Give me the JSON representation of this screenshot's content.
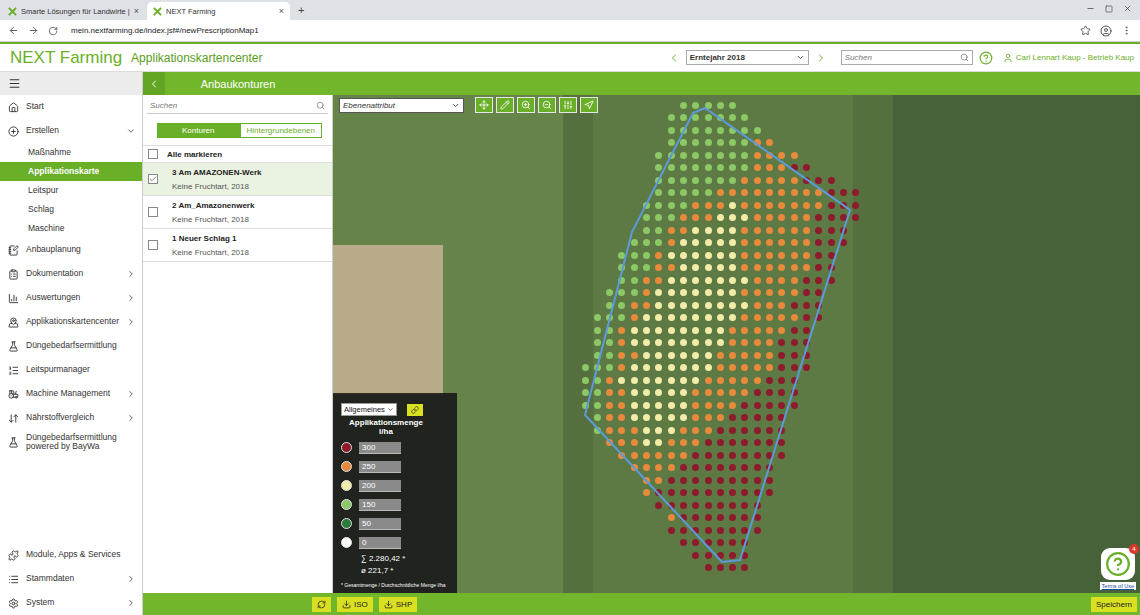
{
  "browser": {
    "tabs": [
      {
        "label": "Smarte Lösungen für Landwirte |",
        "close": "×",
        "selected": false
      },
      {
        "label": "NEXT Farming",
        "close": "×",
        "selected": true
      }
    ],
    "new_tab": "+",
    "url": "mein.nextfarming.de/index.jsf#/newPrescriptionMap1"
  },
  "app_header": {
    "logo": "NEXT Farming",
    "title": "Applikationskartencenter",
    "year": "Erntejahr 2018",
    "search_placeholder": "Suchen",
    "user": "Carl Lennart Kaup - Betrieb Kaup"
  },
  "sidebar": {
    "items": [
      {
        "label": "Start",
        "kind": "top",
        "expandable": false,
        "expanded": false,
        "selected": false
      },
      {
        "label": "Erstellen",
        "kind": "top",
        "expandable": true,
        "expanded": true,
        "selected": false
      },
      {
        "label": "Maßnahme",
        "kind": "sub",
        "expandable": false,
        "expanded": false,
        "selected": false
      },
      {
        "label": "Applikationskarte",
        "kind": "sub",
        "expandable": false,
        "expanded": false,
        "selected": true
      },
      {
        "label": "Leitspur",
        "kind": "sub",
        "expandable": false,
        "expanded": false,
        "selected": false
      },
      {
        "label": "Schlag",
        "kind": "sub",
        "expandable": false,
        "expanded": false,
        "selected": false
      },
      {
        "label": "Maschine",
        "kind": "sub",
        "expandable": false,
        "expanded": false,
        "selected": false
      },
      {
        "label": "Anbauplanung",
        "kind": "top",
        "expandable": false,
        "expanded": false,
        "selected": false
      },
      {
        "label": "Dokumentation",
        "kind": "top",
        "expandable": true,
        "expanded": false,
        "selected": false
      },
      {
        "label": "Auswertungen",
        "kind": "top",
        "expandable": true,
        "expanded": false,
        "selected": false
      },
      {
        "label": "Applikationskartencenter",
        "kind": "top",
        "expandable": true,
        "expanded": false,
        "selected": false
      },
      {
        "label": "Düngebedarfsermittlung",
        "kind": "top",
        "expandable": false,
        "expanded": false,
        "selected": false
      },
      {
        "label": "Leitspurmanager",
        "kind": "top",
        "expandable": false,
        "expanded": false,
        "selected": false
      },
      {
        "label": "Machine Management",
        "kind": "top",
        "expandable": true,
        "expanded": false,
        "selected": false
      },
      {
        "label": "Nährstoffvergleich",
        "kind": "top",
        "expandable": true,
        "expanded": false,
        "selected": false
      },
      {
        "label": "Düngebedarfsermittlung powered by BayWa",
        "kind": "top",
        "expandable": false,
        "expanded": false,
        "selected": false
      }
    ],
    "footer_items": [
      {
        "label": "Module, Apps & Services",
        "kind": "top",
        "expandable": false,
        "expanded": false,
        "selected": false
      },
      {
        "label": "Stammdaten",
        "kind": "top",
        "expandable": true,
        "expanded": false,
        "selected": false
      },
      {
        "label": "System",
        "kind": "top",
        "expandable": true,
        "expanded": false,
        "selected": false
      }
    ]
  },
  "panel": {
    "title": "Anbaukonturen",
    "search_placeholder": "Suchen",
    "toggle": [
      {
        "label": "Konturen",
        "selected": true
      },
      {
        "label": "Hintergrundebenen",
        "selected": false
      }
    ],
    "select_all": {
      "label": "Alle markieren",
      "checked": false
    },
    "fields": [
      {
        "name": "3 Am AMAZONEN-Werk",
        "info": "Keine Fruchtart, 2018",
        "checked": true,
        "selected": true
      },
      {
        "name": "2 Am_Amazonenwerk",
        "info": "Keine Fruchtart, 2018",
        "checked": false,
        "selected": false
      },
      {
        "name": "1 Neuer Schlag 1",
        "info": "Keine Fruchtart, 2018",
        "checked": false,
        "selected": false
      }
    ]
  },
  "map": {
    "layer_select": "Ebenenattribut",
    "legend": {
      "select": "Allgemeines",
      "title": "Applikationsmenge",
      "unit": "l/ha",
      "items": [
        {
          "value": "300",
          "color": "#8e1b2c"
        },
        {
          "value": "250",
          "color": "#e88a3c"
        },
        {
          "value": "200",
          "color": "#f3eca8"
        },
        {
          "value": "150",
          "color": "#8cc866"
        },
        {
          "value": "50",
          "color": "#2d7a3a"
        },
        {
          "value": "0",
          "color": "#ffffff"
        }
      ],
      "sum": "∑ 2.280,42 *",
      "avg": "ø 221,7 *",
      "note": "* Gesamtmenge / Durchschnittliche Menge l/ha"
    },
    "dots": {
      "rows": [
        {
          "start": 8,
          "values": [
            150,
            150,
            150,
            150,
            150
          ]
        },
        {
          "start": 7,
          "values": [
            150,
            150,
            150,
            150,
            150,
            150,
            150
          ]
        },
        {
          "start": 7,
          "values": [
            150,
            150,
            150,
            150,
            150,
            150,
            150,
            150
          ]
        },
        {
          "start": 7,
          "values": [
            150,
            150,
            150,
            150,
            150,
            150,
            150,
            250,
            250
          ]
        },
        {
          "start": 6,
          "values": [
            150,
            150,
            150,
            150,
            150,
            150,
            150,
            150,
            250,
            250,
            250,
            250
          ]
        },
        {
          "start": 6,
          "values": [
            150,
            150,
            150,
            150,
            150,
            150,
            150,
            150,
            250,
            250,
            250,
            300,
            300
          ]
        },
        {
          "start": 6,
          "values": [
            150,
            150,
            150,
            150,
            150,
            150,
            150,
            250,
            250,
            250,
            250,
            250,
            300,
            300,
            300
          ]
        },
        {
          "start": 6,
          "values": [
            150,
            150,
            150,
            150,
            150,
            250,
            250,
            250,
            250,
            250,
            250,
            250,
            250,
            250,
            300,
            300,
            300
          ]
        },
        {
          "start": 5,
          "values": [
            150,
            150,
            150,
            150,
            250,
            250,
            250,
            200,
            250,
            250,
            250,
            250,
            250,
            250,
            250,
            300,
            300,
            300
          ]
        },
        {
          "start": 5,
          "values": [
            150,
            150,
            150,
            250,
            250,
            250,
            200,
            200,
            200,
            250,
            250,
            250,
            250,
            250,
            300,
            300,
            300,
            300
          ]
        },
        {
          "start": 5,
          "values": [
            150,
            150,
            250,
            250,
            200,
            200,
            200,
            200,
            250,
            250,
            250,
            250,
            250,
            250,
            300,
            300,
            300
          ]
        },
        {
          "start": 4,
          "values": [
            150,
            150,
            150,
            250,
            200,
            200,
            200,
            200,
            200,
            250,
            250,
            250,
            250,
            250,
            250,
            300,
            300,
            300
          ]
        },
        {
          "start": 3,
          "values": [
            150,
            150,
            150,
            250,
            200,
            200,
            200,
            200,
            200,
            200,
            250,
            250,
            250,
            250,
            250,
            250,
            300,
            300
          ]
        },
        {
          "start": 3,
          "values": [
            150,
            150,
            150,
            250,
            250,
            200,
            200,
            200,
            200,
            200,
            250,
            250,
            250,
            250,
            250,
            250,
            300,
            300
          ]
        },
        {
          "start": 3,
          "values": [
            150,
            150,
            250,
            250,
            200,
            200,
            200,
            200,
            200,
            200,
            200,
            250,
            250,
            250,
            250,
            300,
            300,
            300
          ]
        },
        {
          "start": 2,
          "values": [
            150,
            150,
            150,
            250,
            200,
            200,
            200,
            200,
            200,
            200,
            200,
            250,
            250,
            250,
            250,
            250,
            300,
            300
          ]
        },
        {
          "start": 2,
          "values": [
            150,
            150,
            250,
            250,
            200,
            200,
            200,
            200,
            200,
            200,
            200,
            200,
            250,
            250,
            250,
            300,
            300,
            300
          ]
        },
        {
          "start": 1,
          "values": [
            150,
            150,
            150,
            250,
            200,
            200,
            200,
            200,
            200,
            200,
            200,
            200,
            250,
            250,
            250,
            250,
            250,
            300,
            300
          ]
        },
        {
          "start": 1,
          "values": [
            150,
            150,
            250,
            200,
            200,
            200,
            200,
            200,
            200,
            200,
            200,
            250,
            250,
            250,
            250,
            250,
            300,
            300
          ]
        },
        {
          "start": 1,
          "values": [
            150,
            150,
            250,
            200,
            200,
            200,
            200,
            200,
            200,
            200,
            200,
            250,
            250,
            250,
            250,
            300,
            300,
            300
          ]
        },
        {
          "start": 1,
          "values": [
            150,
            150,
            250,
            250,
            200,
            200,
            200,
            200,
            200,
            200,
            250,
            250,
            250,
            250,
            250,
            300,
            300,
            300
          ]
        },
        {
          "start": 0,
          "values": [
            150,
            150,
            150,
            250,
            200,
            200,
            200,
            200,
            200,
            200,
            200,
            250,
            250,
            250,
            250,
            250,
            300,
            300,
            300
          ]
        },
        {
          "start": 0,
          "values": [
            150,
            150,
            250,
            200,
            200,
            200,
            200,
            200,
            200,
            200,
            250,
            250,
            250,
            250,
            250,
            300,
            300,
            300
          ]
        },
        {
          "start": 0,
          "values": [
            150,
            150,
            250,
            250,
            200,
            200,
            200,
            200,
            200,
            250,
            250,
            250,
            250,
            250,
            300,
            300,
            300,
            300
          ]
        },
        {
          "start": 0,
          "values": [
            150,
            150,
            250,
            250,
            200,
            200,
            200,
            200,
            200,
            250,
            250,
            250,
            250,
            300,
            300,
            300,
            300,
            300
          ]
        },
        {
          "start": 1,
          "values": [
            150,
            250,
            250,
            200,
            200,
            200,
            200,
            200,
            250,
            250,
            250,
            300,
            300,
            300,
            300,
            300
          ]
        },
        {
          "start": 1,
          "values": [
            150,
            250,
            250,
            250,
            200,
            200,
            200,
            250,
            250,
            250,
            300,
            300,
            300,
            300,
            300,
            300
          ]
        },
        {
          "start": 2,
          "values": [
            250,
            250,
            250,
            200,
            200,
            250,
            250,
            250,
            300,
            300,
            300,
            300,
            300,
            300,
            300
          ]
        },
        {
          "start": 3,
          "values": [
            250,
            250,
            250,
            250,
            250,
            250,
            300,
            300,
            300,
            300,
            300,
            300,
            300,
            300
          ]
        },
        {
          "start": 4,
          "values": [
            250,
            250,
            250,
            250,
            300,
            300,
            300,
            300,
            300,
            300,
            300,
            300
          ]
        },
        {
          "start": 5,
          "values": [
            250,
            250,
            300,
            300,
            300,
            300,
            300,
            300,
            300,
            300,
            300
          ]
        },
        {
          "start": 5,
          "values": [
            250,
            300,
            300,
            300,
            300,
            300,
            300,
            300,
            300,
            300,
            300
          ]
        },
        {
          "start": 6,
          "values": [
            300,
            300,
            300,
            300,
            300,
            300,
            300,
            300,
            300
          ]
        },
        {
          "start": 7,
          "values": [
            250,
            300,
            300,
            300,
            300,
            300,
            300,
            300
          ]
        },
        {
          "start": 7,
          "values": [
            300,
            300,
            300,
            300,
            300,
            300,
            300,
            300
          ]
        },
        {
          "start": 8,
          "values": [
            300,
            300,
            300,
            300,
            300,
            300
          ]
        },
        {
          "start": 9,
          "values": [
            300,
            300,
            300,
            300,
            300
          ]
        },
        {
          "start": 10,
          "values": [
            300,
            300,
            300,
            300
          ]
        }
      ]
    }
  },
  "help": {
    "badge": "4",
    "terms": "Terms of Use"
  },
  "bottom_bar": {
    "buttons": [
      {
        "label": "ISO"
      },
      {
        "label": "SHP"
      }
    ],
    "save": "Speichern"
  }
}
